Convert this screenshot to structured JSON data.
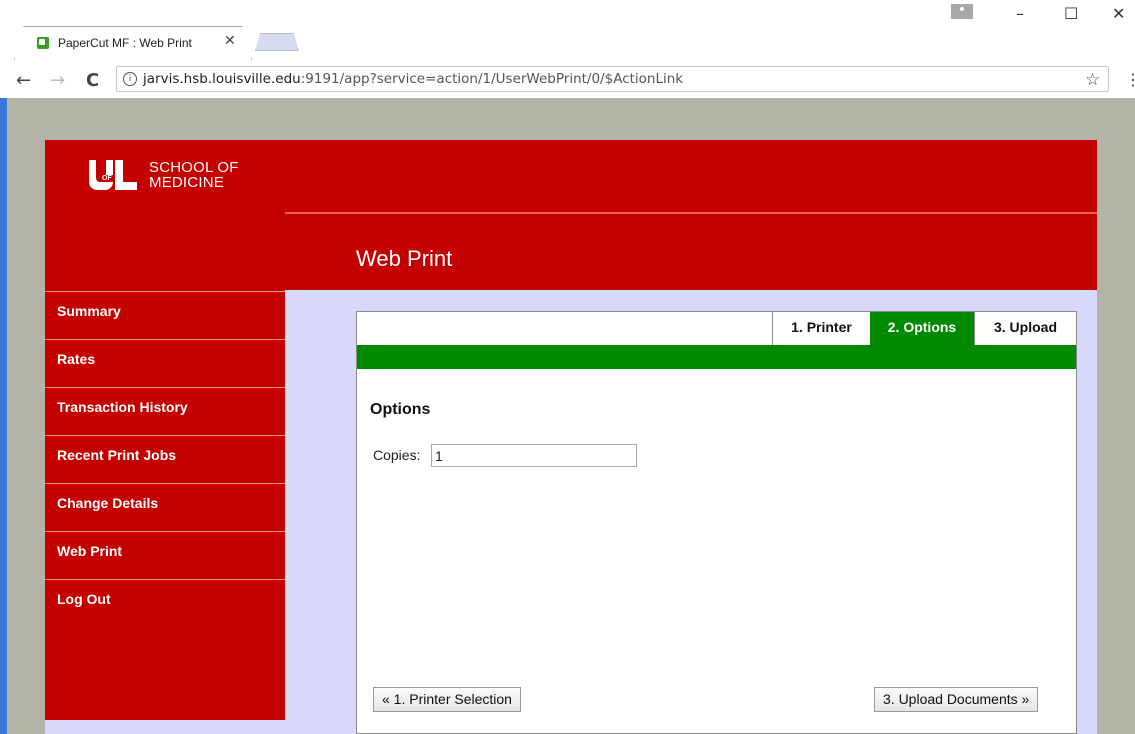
{
  "browser": {
    "tab_title": "PaperCut MF : Web Print",
    "tab_close": "✕",
    "url_host": "jarvis.hsb.louisville.edu",
    "url_rest": ":9191/app?service=action/1/UserWebPrint/0/$ActionLink",
    "icons": [
      "back-icon",
      "forward-icon",
      "reload-icon",
      "info-icon",
      "star-icon",
      "menu-icon",
      "minimize-icon",
      "maximize-icon",
      "close-icon"
    ],
    "window": {
      "minimize": "–",
      "maximize": "☐",
      "close": "✕"
    },
    "nav": {
      "back": "←",
      "forward": "→",
      "reload": "C",
      "info": "i",
      "star": "☆",
      "menu": "⋮"
    }
  },
  "header": {
    "logo_line1": "SCHOOL OF",
    "logo_line2": "MEDICINE",
    "logo_of": "OF",
    "title": "Web Print"
  },
  "sidebar": {
    "items": [
      {
        "label": "Summary"
      },
      {
        "label": "Rates"
      },
      {
        "label": "Transaction History"
      },
      {
        "label": "Recent Print Jobs"
      },
      {
        "label": "Change Details"
      },
      {
        "label": "Web Print"
      },
      {
        "label": "Log Out"
      }
    ]
  },
  "wizard": {
    "tabs": [
      {
        "label": "1. Printer",
        "active": false
      },
      {
        "label": "2. Options",
        "active": true
      },
      {
        "label": "3. Upload",
        "active": false
      }
    ],
    "section_title": "Options",
    "copies_label": "Copies:",
    "copies_value": "1",
    "prev_button": "« 1. Printer Selection",
    "next_button": "3. Upload Documents »"
  },
  "colors": {
    "brand_red": "#c50000",
    "step_green": "#008a00",
    "page_lavender": "#d8d8fb"
  }
}
